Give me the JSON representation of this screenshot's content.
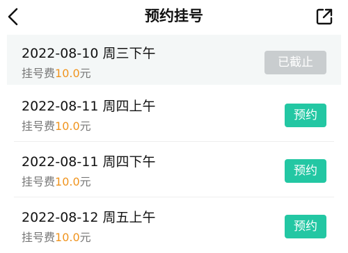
{
  "header": {
    "title": "预约挂号"
  },
  "fee_label": "挂号费",
  "fee_unit": "元",
  "slots": [
    {
      "date": "2022-08-10 周三下午",
      "fee": "10.0",
      "action": "已截止",
      "status": "closed"
    },
    {
      "date": "2022-08-11 周四上午",
      "fee": "10.0",
      "action": "预约",
      "status": "open"
    },
    {
      "date": "2022-08-11 周四下午",
      "fee": "10.0",
      "action": "预约",
      "status": "open"
    },
    {
      "date": "2022-08-12 周五上午",
      "fee": "10.0",
      "action": "预约",
      "status": "open"
    }
  ],
  "colors": {
    "accent": "#23c7a3",
    "fee_amount": "#f0941e",
    "disabled": "#c9cdcf"
  }
}
